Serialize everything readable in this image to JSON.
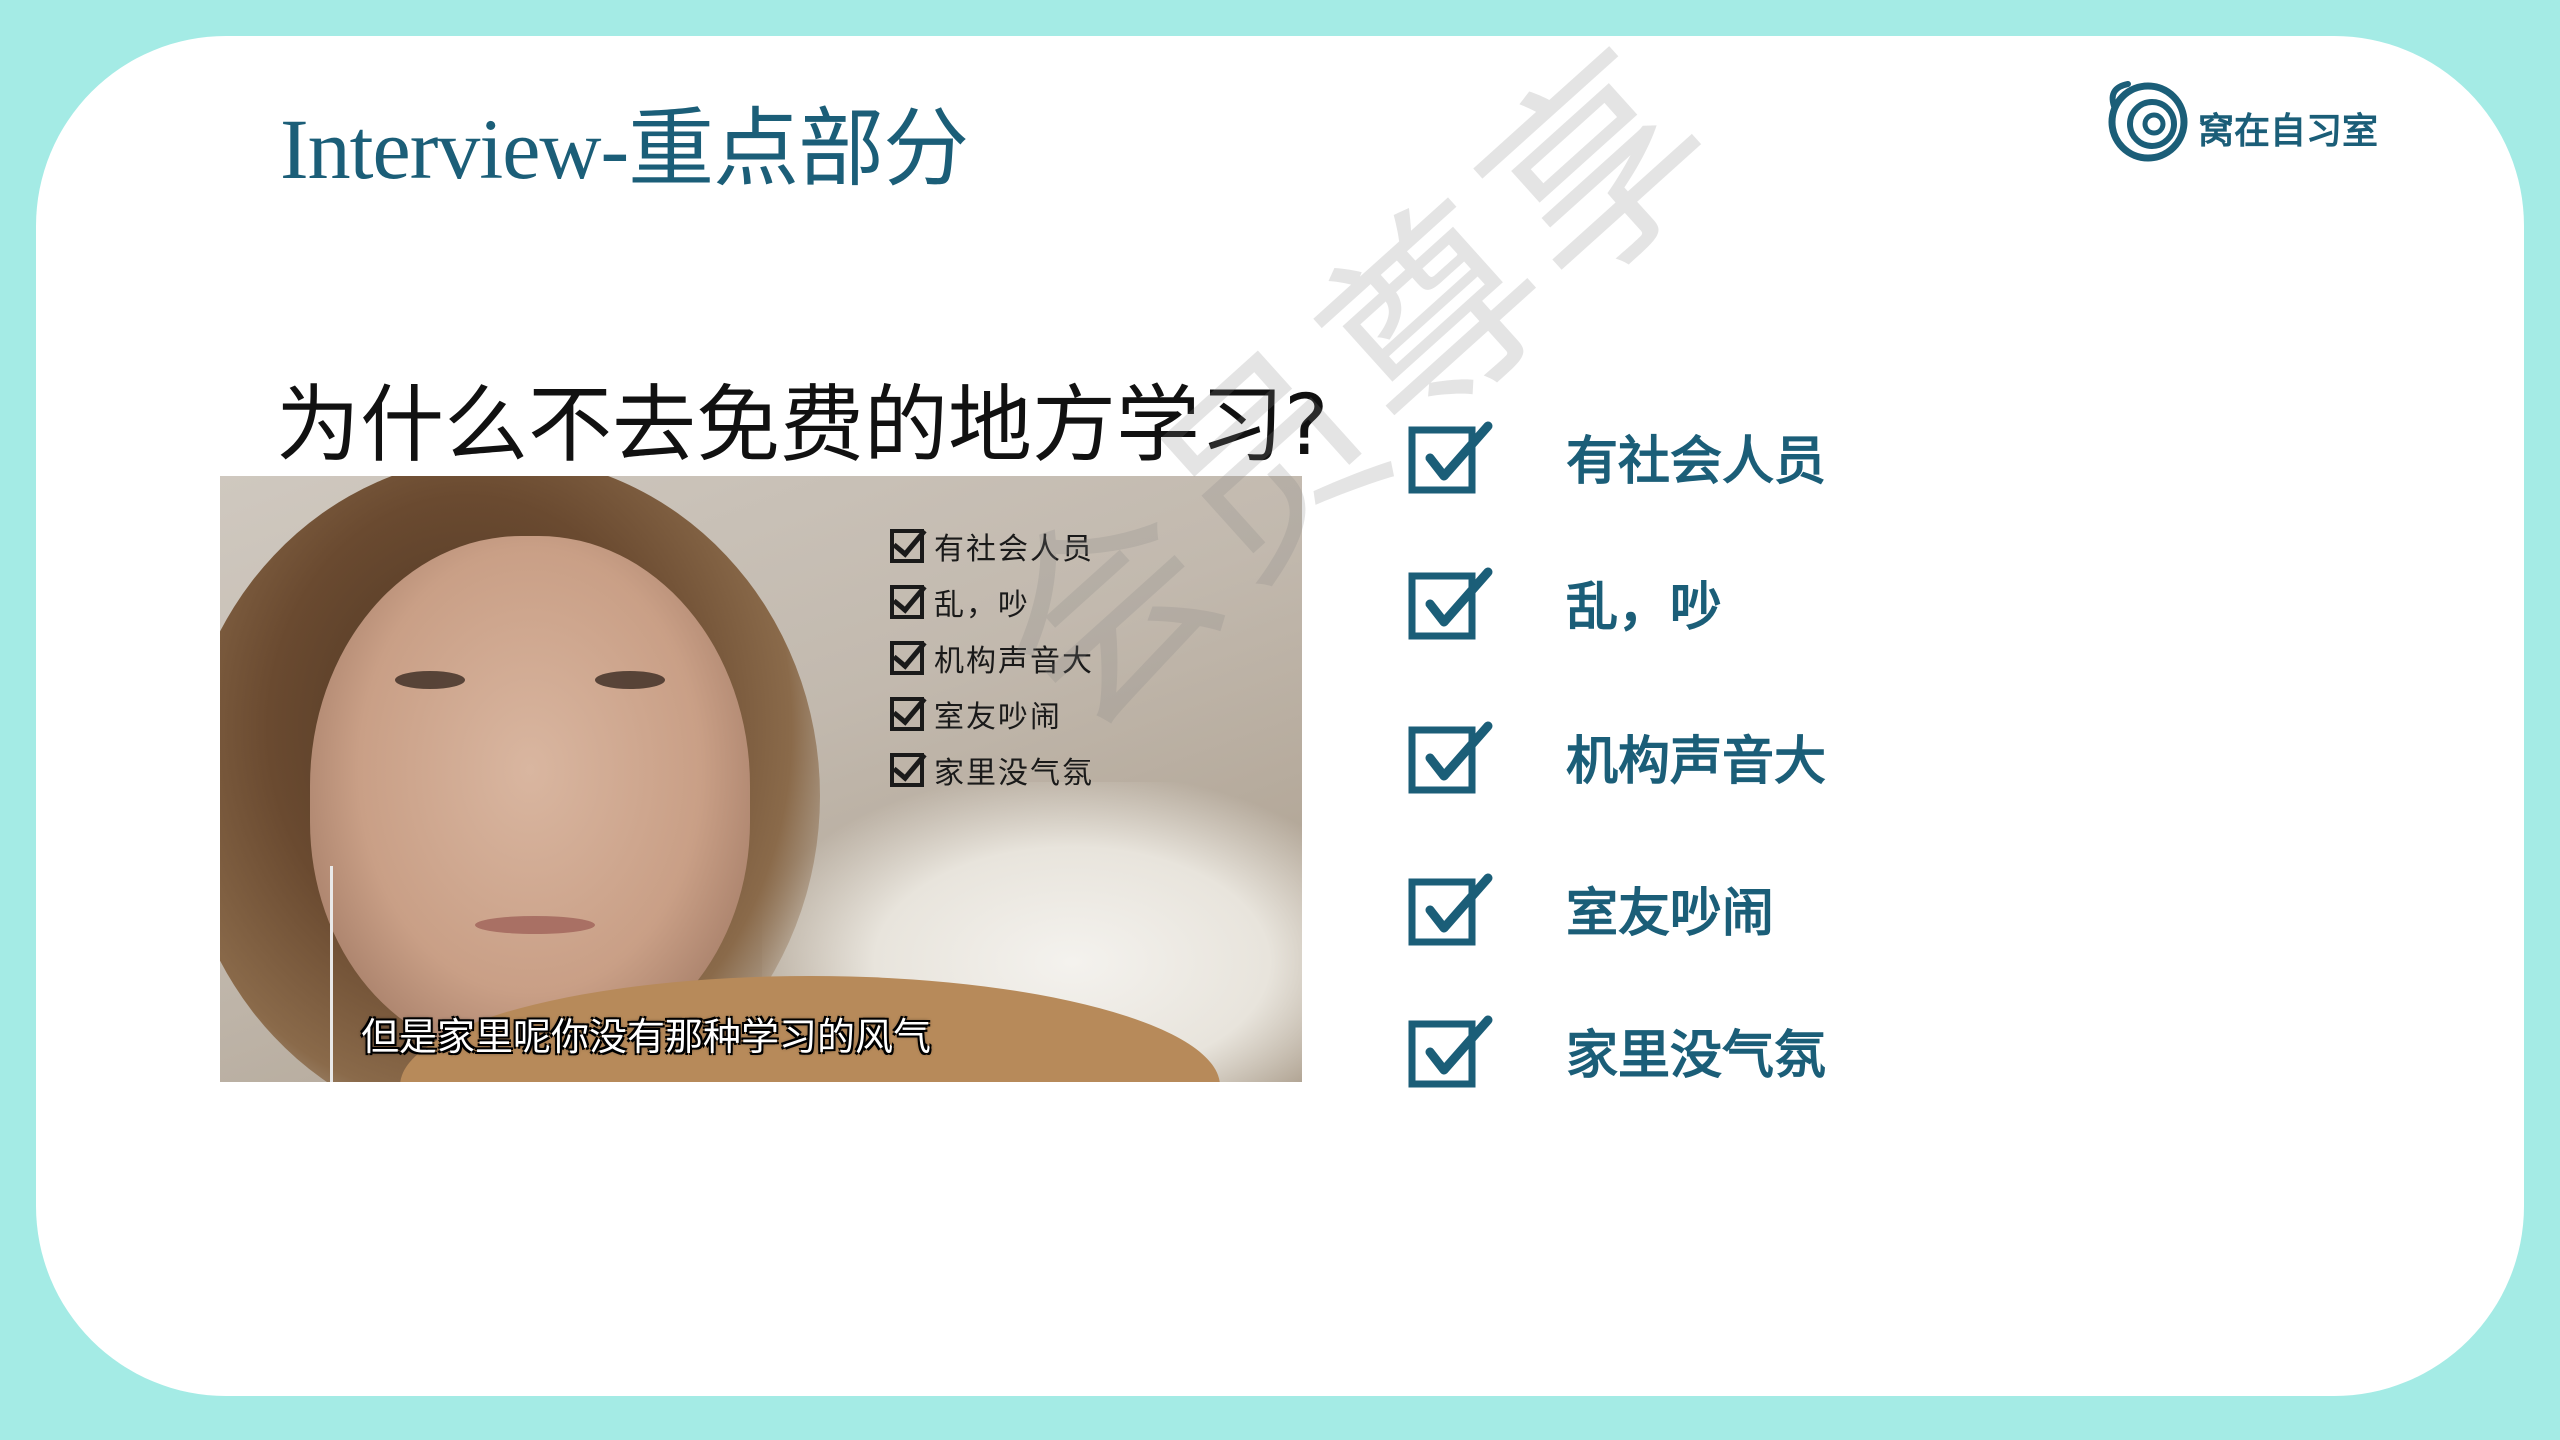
{
  "slide": {
    "title": "Interview-重点部分",
    "logo_text": "窝在自习室",
    "question": "为什么不去免费的地方学习?"
  },
  "video": {
    "overlay_items": [
      "有社会人员",
      "乱，吵",
      "机构声音大",
      "室友吵闹",
      "家里没气氛"
    ],
    "subtitle": "但是家里呢你没有那种学习的风气"
  },
  "checklist": {
    "items": [
      "有社会人员",
      "乱，吵",
      "机构声音大",
      "室友吵闹",
      "家里没气氛"
    ]
  },
  "watermark": "会员尊享",
  "colors": {
    "frame": "#a4ebe5",
    "accent": "#1b5e78",
    "text": "#111111"
  },
  "icons": {
    "logo": "spiral-logo-icon",
    "check": "checkbox-checked-icon"
  }
}
